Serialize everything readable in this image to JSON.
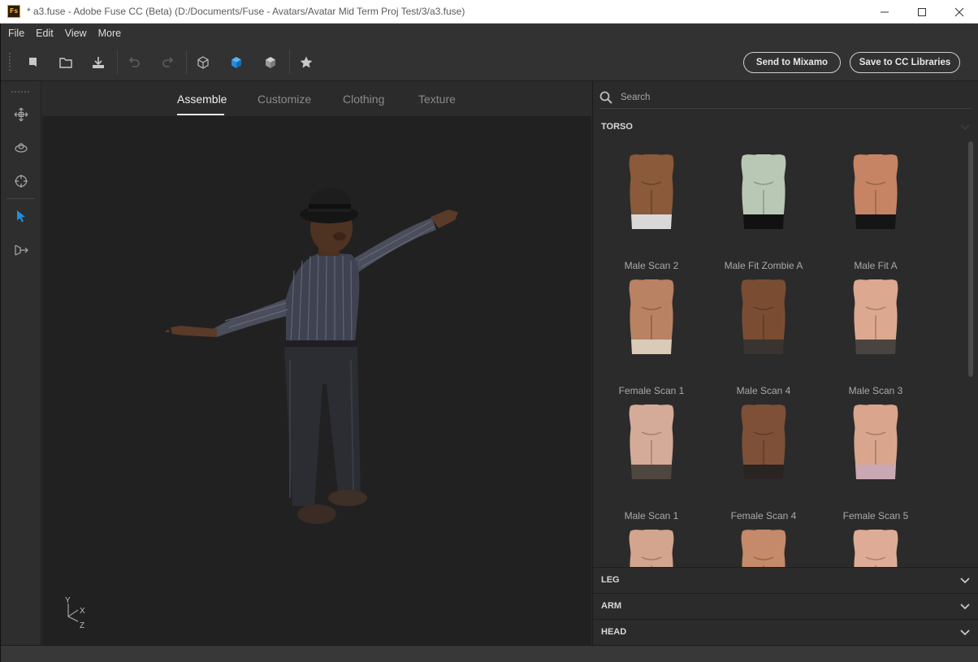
{
  "window": {
    "title": "* a3.fuse - Adobe Fuse CC (Beta) (D:/Documents/Fuse - Avatars/Avatar Mid Term Proj Test/3/a3.fuse)",
    "app_icon_text": "Fs"
  },
  "menu": [
    "File",
    "Edit",
    "View",
    "More"
  ],
  "toolbar": {
    "send_label": "Send to Mixamo",
    "save_label": "Save to CC Libraries"
  },
  "tabs": [
    {
      "label": "Assemble",
      "active": true
    },
    {
      "label": "Customize",
      "active": false
    },
    {
      "label": "Clothing",
      "active": false
    },
    {
      "label": "Texture",
      "active": false
    }
  ],
  "axis": {
    "y": "Y",
    "x": "X",
    "z": "Z"
  },
  "search": {
    "placeholder": "Search"
  },
  "categories": {
    "torso": "TORSO",
    "leg": "LEG",
    "arm": "ARM",
    "head": "HEAD"
  },
  "torso_items": [
    {
      "label": "Male Scan 2",
      "skin": "#8a5a3a",
      "under": "#d8d8d8"
    },
    {
      "label": "Male Fit Zombie A",
      "skin": "#b9c8b4",
      "under": "#111111"
    },
    {
      "label": "Male Fit A",
      "skin": "#c68464",
      "under": "#151515"
    },
    {
      "label": "Female Scan 1",
      "skin": "#b98262",
      "under": "#d9cbb8"
    },
    {
      "label": "Male Scan 4",
      "skin": "#7a4d33",
      "under": "#3a3430"
    },
    {
      "label": "Male Scan 3",
      "skin": "#dca890",
      "under": "#4a4440"
    },
    {
      "label": "Male Scan 1",
      "skin": "#d4ab98",
      "under": "#4e4740"
    },
    {
      "label": "Female Scan 4",
      "skin": "#7e5038",
      "under": "#2a2422"
    },
    {
      "label": "Female Scan 5",
      "skin": "#d9a58c",
      "under": "#c9a8b4"
    },
    {
      "label": "",
      "skin": "#d3a48e",
      "under": "#2a2a2a"
    },
    {
      "label": "",
      "skin": "#c48a6a",
      "under": "#0d0d0d"
    },
    {
      "label": "",
      "skin": "#deac96",
      "under": "#d4a090"
    }
  ],
  "colors": {
    "accent": "#1e8fe0",
    "viewport_bg": "#212121",
    "panel_bg": "#2b2b2b"
  }
}
